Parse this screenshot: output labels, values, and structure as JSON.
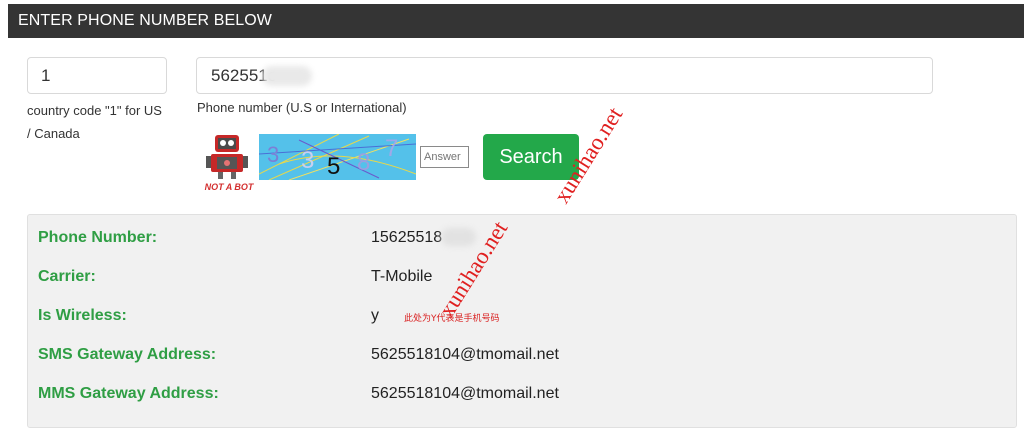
{
  "header": {
    "title": "ENTER PHONE NUMBER BELOW"
  },
  "form": {
    "country_code_value": "1",
    "country_code_help": "country code \"1\" for US / Canada",
    "phone_value": "562551c",
    "phone_help": "Phone number (U.S or International)",
    "robot_caption": "NOT A BOT",
    "captcha_digits": [
      "3",
      "3",
      "5",
      "8",
      "7"
    ],
    "answer_placeholder": "Answer",
    "search_label": "Search"
  },
  "results": {
    "phone_label": "Phone Number:",
    "phone_value": "15625518",
    "carrier_label": "Carrier:",
    "carrier_value": "T-Mobile",
    "wireless_label": "Is Wireless:",
    "wireless_value": "y",
    "wireless_note": "此处为Y代表是手机号码",
    "sms_label": "SMS Gateway Address:",
    "sms_value": "5625518104@tmomail.net",
    "mms_label": "MMS Gateway Address:",
    "mms_value": "5625518104@tmomail.net"
  },
  "watermark": "xunihao.net",
  "colors": {
    "header_bg": "#343434",
    "accent_green": "#23a84a",
    "label_green": "#2f9e44",
    "watermark_red": "#e02020"
  },
  "icons": [
    "robot-icon"
  ]
}
